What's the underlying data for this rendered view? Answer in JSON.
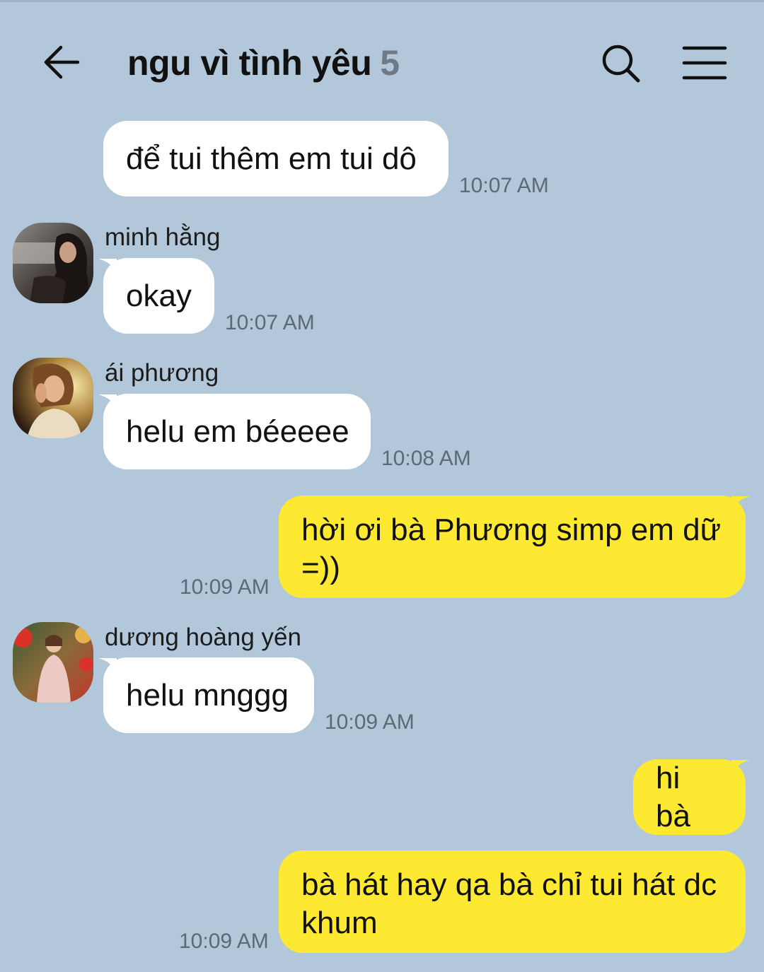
{
  "header": {
    "title": "ngu vì tình yêu",
    "member_count": "5",
    "back_icon": "back-arrow-icon",
    "search_icon": "search-icon",
    "menu_icon": "hamburger-menu-icon"
  },
  "colors": {
    "background": "#b2c7d9",
    "incoming_bubble": "#ffffff",
    "outgoing_bubble": "#fde932",
    "timestamp": "#5d6a75"
  },
  "messages": [
    {
      "direction": "incoming",
      "sender": "",
      "text": "để tui thêm em tui dô",
      "time": "10:07 AM"
    },
    {
      "direction": "incoming",
      "sender": "minh hằng",
      "text": "okay",
      "time": "10:07 AM"
    },
    {
      "direction": "incoming",
      "sender": "ái phương",
      "text": "helu em béeeee",
      "time": "10:08 AM"
    },
    {
      "direction": "outgoing",
      "sender": "",
      "text": "hời ơi bà Phương simp em dữ =))",
      "time": "10:09 AM"
    },
    {
      "direction": "incoming",
      "sender": "dương hoàng yến",
      "text": "helu mnggg",
      "time": "10:09 AM"
    },
    {
      "direction": "outgoing",
      "sender": "",
      "text": "hi bà",
      "time": ""
    },
    {
      "direction": "outgoing",
      "sender": "",
      "text": "bà hát hay qa bà chỉ tui hát dc khum",
      "time": "10:09 AM"
    }
  ]
}
